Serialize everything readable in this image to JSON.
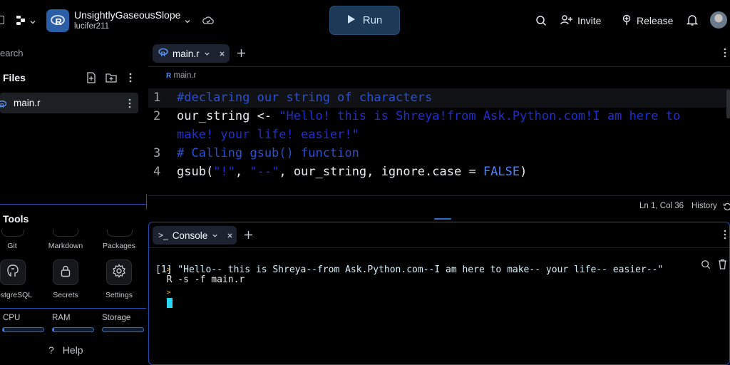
{
  "repl": {
    "title": "UnsightlyGaseousSlope",
    "owner": "lucifer211",
    "language_badge": "R"
  },
  "toolbar": {
    "run_label": "Run",
    "invite_label": "Invite",
    "release_label": "Release"
  },
  "sidebar": {
    "search_label": "earch",
    "files_heading": "Files",
    "files": [
      {
        "name": "main.r",
        "active": true
      }
    ],
    "tools_heading": "Tools",
    "tools": [
      {
        "label": "Git",
        "icon": "git-icon"
      },
      {
        "label": "Markdown",
        "icon": "markdown-icon"
      },
      {
        "label": "Packages",
        "icon": "package-icon"
      },
      {
        "label": "ostgreSQL",
        "icon": "postgres-icon"
      },
      {
        "label": "Secrets",
        "icon": "lock-icon"
      },
      {
        "label": "Settings",
        "icon": "gear-icon"
      }
    ],
    "resources": [
      {
        "label": "CPU",
        "level": 0.04
      },
      {
        "label": "RAM",
        "level": 0.04
      },
      {
        "label": "Storage",
        "level": 0.0
      }
    ],
    "help_label": "Help"
  },
  "editor": {
    "tab_label": "main.r",
    "breadcrumb": "main.r",
    "line_numbers": [
      "1",
      "2",
      "",
      "3",
      "4"
    ],
    "lines": [
      {
        "parts": [
          {
            "t": "#declaring our string of characters",
            "c": "cmt"
          }
        ]
      },
      {
        "parts": [
          {
            "t": "our_string <- ",
            "c": "txt"
          },
          {
            "t": "\"Hello! this is Shreya!from Ask.Python.com!I am here to",
            "c": "str"
          }
        ]
      },
      {
        "parts": [
          {
            "t": "make! your life! easier!\"",
            "c": "str"
          }
        ]
      },
      {
        "parts": [
          {
            "t": "# Calling gsub() function",
            "c": "cmt"
          }
        ]
      },
      {
        "parts": [
          {
            "t": "gsub(",
            "c": "txt"
          },
          {
            "t": "\"!\"",
            "c": "str"
          },
          {
            "t": ", ",
            "c": "txt"
          },
          {
            "t": "\"--\"",
            "c": "str"
          },
          {
            "t": ", our_string, ignore.case = ",
            "c": "txt"
          },
          {
            "t": "FALSE",
            "c": "kw"
          },
          {
            "t": ")",
            "c": "txt"
          }
        ]
      }
    ],
    "cursor_position": "Ln 1, Col 36",
    "history_label": "History"
  },
  "console": {
    "tab_label": "Console",
    "command": "R -s -f main.r",
    "output": "[1] \"Hello-- this is Shreya--from Ask.Python.com--I am here to make-- your life-- easier--\"",
    "prompt_symbol": ">"
  },
  "colors": {
    "accent_blue": "#1e4fae",
    "run_button_bg": "#1c3a57",
    "comment": "#2b4fd1",
    "string": "#1f2fcf",
    "keyword": "#4f83f2",
    "cursor": "#28d7f0"
  }
}
